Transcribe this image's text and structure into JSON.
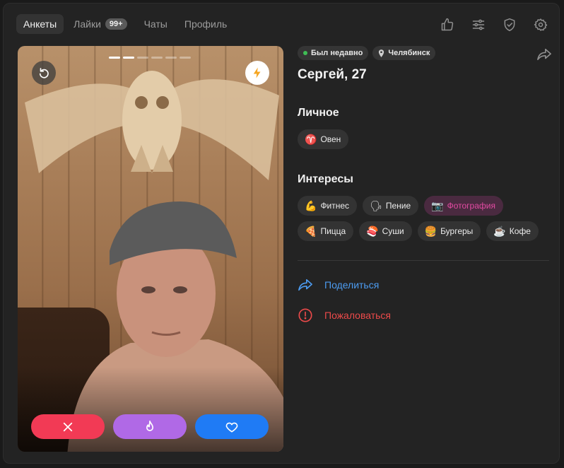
{
  "nav": {
    "tabs": [
      {
        "label": "Анкеты",
        "active": true
      },
      {
        "label": "Лайки",
        "badge": "99+"
      },
      {
        "label": "Чаты"
      },
      {
        "label": "Профиль"
      }
    ],
    "icons": [
      "thumbs-up-icon",
      "filters-icon",
      "shield-check-icon",
      "gear-icon"
    ]
  },
  "photo": {
    "photo_count": 6,
    "current_photo": 2
  },
  "profile": {
    "status": "Был недавно",
    "city": "Челябинск",
    "name": "Сергей, 27",
    "personal_title": "Личное",
    "personal_tags": [
      {
        "icon": "♈",
        "label": "Овен"
      }
    ],
    "interests_title": "Интересы",
    "interests": [
      {
        "icon": "💪",
        "label": "Фитнес",
        "highlight": false
      },
      {
        "icon": "🗣",
        "label": "Пение",
        "highlight": false
      },
      {
        "icon": "📷",
        "label": "Фотография",
        "highlight": true
      },
      {
        "icon": "🍕",
        "label": "Пицца",
        "highlight": false
      },
      {
        "icon": "🍣",
        "label": "Суши",
        "highlight": false
      },
      {
        "icon": "🍔",
        "label": "Бургеры",
        "highlight": false
      },
      {
        "icon": "☕",
        "label": "Кофе",
        "highlight": false
      }
    ]
  },
  "links": {
    "share": "Поделиться",
    "report": "Пожаловаться"
  },
  "colors": {
    "nope": "#f23a55",
    "super": "#b069e6",
    "like": "#1f7bf5",
    "share": "#4c9bf0",
    "report": "#ec4a4a",
    "online": "#3fbd55"
  }
}
